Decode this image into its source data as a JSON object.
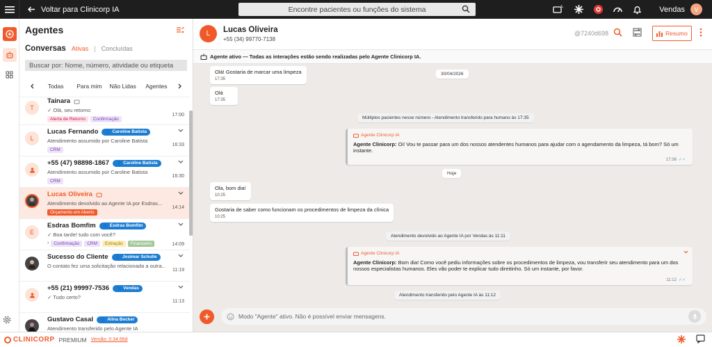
{
  "topbar": {
    "back_label": "Voltar para Clinicorp IA",
    "search_placeholder": "Encontre pacientes ou funções do sistema",
    "user_name": "Vendas",
    "user_initial": "V"
  },
  "sidebar": {
    "title": "Agentes",
    "conversations_label": "Conversas",
    "tab_active": "Ativas",
    "tab_separator": "|",
    "tab_done": "Concluídas",
    "search_placeholder": "Buscar por: Nome, número, atividade ou etiqueta",
    "filters": [
      "Todas",
      "Para mim",
      "Não Lidas",
      "Agentes"
    ],
    "items": [
      {
        "initial": "T",
        "name": "Tainara",
        "preview": "Olá, seu retorno",
        "time": "17:00",
        "tags": [
          "Alerta de Retorno",
          "Confirmação"
        ]
      },
      {
        "initial": "L",
        "name": "Lucas Fernando",
        "badge": "Caroline Batista",
        "preview": "Atendimento assumido por Caroline Batista",
        "time": "16:33",
        "tags": [
          "CRM"
        ]
      },
      {
        "initial": "",
        "name": "+55 (47) 98898-1867",
        "badge": "Caroline Batista",
        "preview": "Atendimento assumido por Caroline Batista",
        "time": "16:30",
        "tags": [
          "CRM"
        ]
      },
      {
        "initial": "",
        "name": "Lucas Oliveira",
        "preview": "Atendimento devolvido ao Agente IA por Esdras...",
        "time": "14:14",
        "tags": [
          "Orçamento em Aberto"
        ]
      },
      {
        "initial": "E",
        "name": "Esdras Bomfim",
        "badge": "Esdras Bomfim",
        "preview": "Boa tarde! tudo com você?",
        "time": "14:09",
        "tags": [
          "Confirmação",
          "CRM",
          "Extração",
          "Financeiro"
        ]
      },
      {
        "initial": "",
        "name": "Sucesso do Cliente",
        "badge": "Josimar Schulle",
        "preview": "O contato fez uma solicitação relacionada a outra...",
        "time": "11:19",
        "tags": []
      },
      {
        "initial": "",
        "name": "+55 (21) 99997-7536",
        "badge": "Vendas",
        "preview": "Tudo certo?",
        "time": "11:13",
        "tags": []
      },
      {
        "initial": "",
        "name": "Gustavo Casal",
        "badge": "Alina Becker",
        "preview": "Atendimento transferido pelo Agente IA",
        "time": "",
        "tags": []
      }
    ]
  },
  "chat": {
    "contact_initial": "L",
    "contact_name": "Lucas Oliveira",
    "contact_phone": "+55 (34) 99770-7138",
    "contact_id": "@7240d698",
    "resumo_label": "Resumo",
    "agent_bar": "Agente ativo — Todas as interações estão sendo realizadas pelo Agente Clinicorp IA.",
    "messages": {
      "m1": {
        "text": "Olá! Gostaria de marcar uma limpeza",
        "time": "17:35"
      },
      "date1": "30/04/2026",
      "m2": {
        "text": "Olá",
        "time": "17:35"
      },
      "sys1": "Múltiplos pacientes nesse número - Atendimento transferido para humano às 17:35",
      "out1": {
        "agent": "Agente Clinicorp IA",
        "bold": "Agente Clinicorp:",
        "text": " Oi! Vou te passar para um dos nossos atendentes humanos para ajudar com o agendamento da limpeza, tá bom? Só um instante.",
        "time": "17:36"
      },
      "date2": "Hoje",
      "m3": {
        "text": "Ola, bom dia!",
        "time": "10:25"
      },
      "m4": {
        "text": "Gostaria de saber como funcionam os procedimentos de limpeza da clínica",
        "time": "10:25"
      },
      "sys2": "Atendimento devolvido ao Agente IA por Vendas às 11:11",
      "out2": {
        "agent": "Agente Clinicorp IA",
        "bold": "Agente Clinicorp:",
        "text": " Bom dia! Como você pediu informações sobre os procedimentos de limpeza, vou transferir seu atendimento para um dos nossos especialistas humanos. Eles vão poder te explicar tudo direitinho. Só um instante, por favor.",
        "time": "11:12"
      },
      "sys3": "Atendimento transferido pelo Agente IA às 11:12"
    },
    "composer_placeholder": "Modo \"Agente\" ativo. Não é possível enviar mensagens."
  },
  "footer": {
    "logo": "CLINICORP",
    "edition": "PREMIUM",
    "version": "Versão: 0.34.66d"
  },
  "colors": {
    "accent": "#f05a2a",
    "badge_blue": "#1d7dd1",
    "topbar": "#1e1e1e"
  }
}
